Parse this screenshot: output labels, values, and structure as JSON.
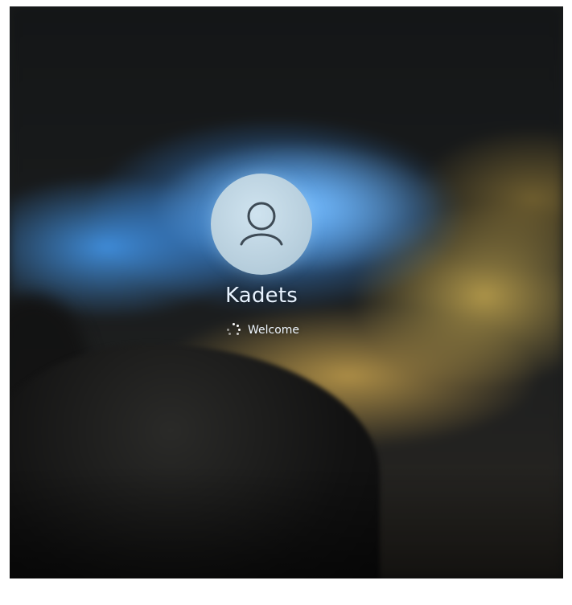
{
  "login": {
    "username": "Kadets",
    "status": "Welcome",
    "user_icon": "user-icon",
    "spinner_icon": "loading-spinner-icon"
  },
  "colors": {
    "text": "#e8f3ff",
    "avatar": "#cfe3ef",
    "blue_glow": "#3c96fa",
    "gold_glow": "#d2aa50"
  }
}
